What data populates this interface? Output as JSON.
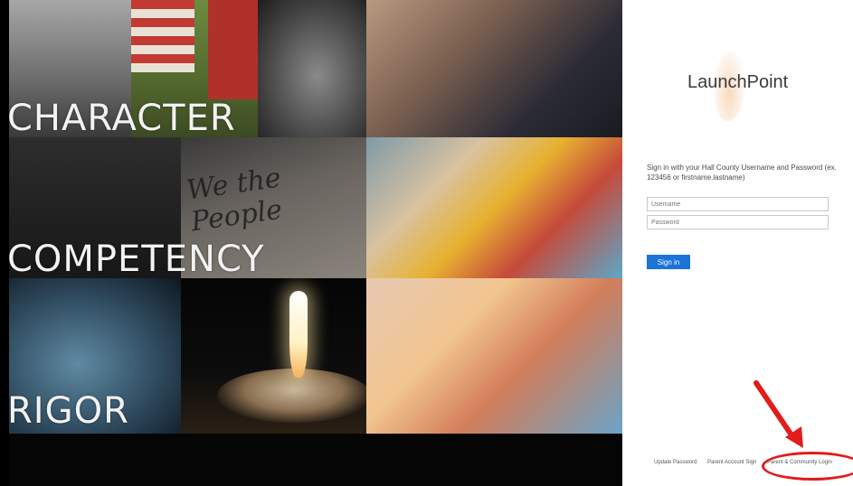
{
  "collage": {
    "labels": {
      "character": "CHARACTER",
      "competency": "COMPETENCY",
      "rigor": "RIGOR"
    },
    "document_text": "We the People"
  },
  "login": {
    "logo_text": "LaunchPoint",
    "instructions": "Sign in with your Hall County Username and Password (ex. 123456 or firstname.lastname)",
    "username_placeholder": "Username",
    "password_placeholder": "Password",
    "signin_label": "Sign in",
    "footer_links": [
      "Update Password",
      "Parent Account Sign",
      "Parent & Community Login"
    ]
  },
  "annotation": {
    "color": "#e21b1b"
  }
}
